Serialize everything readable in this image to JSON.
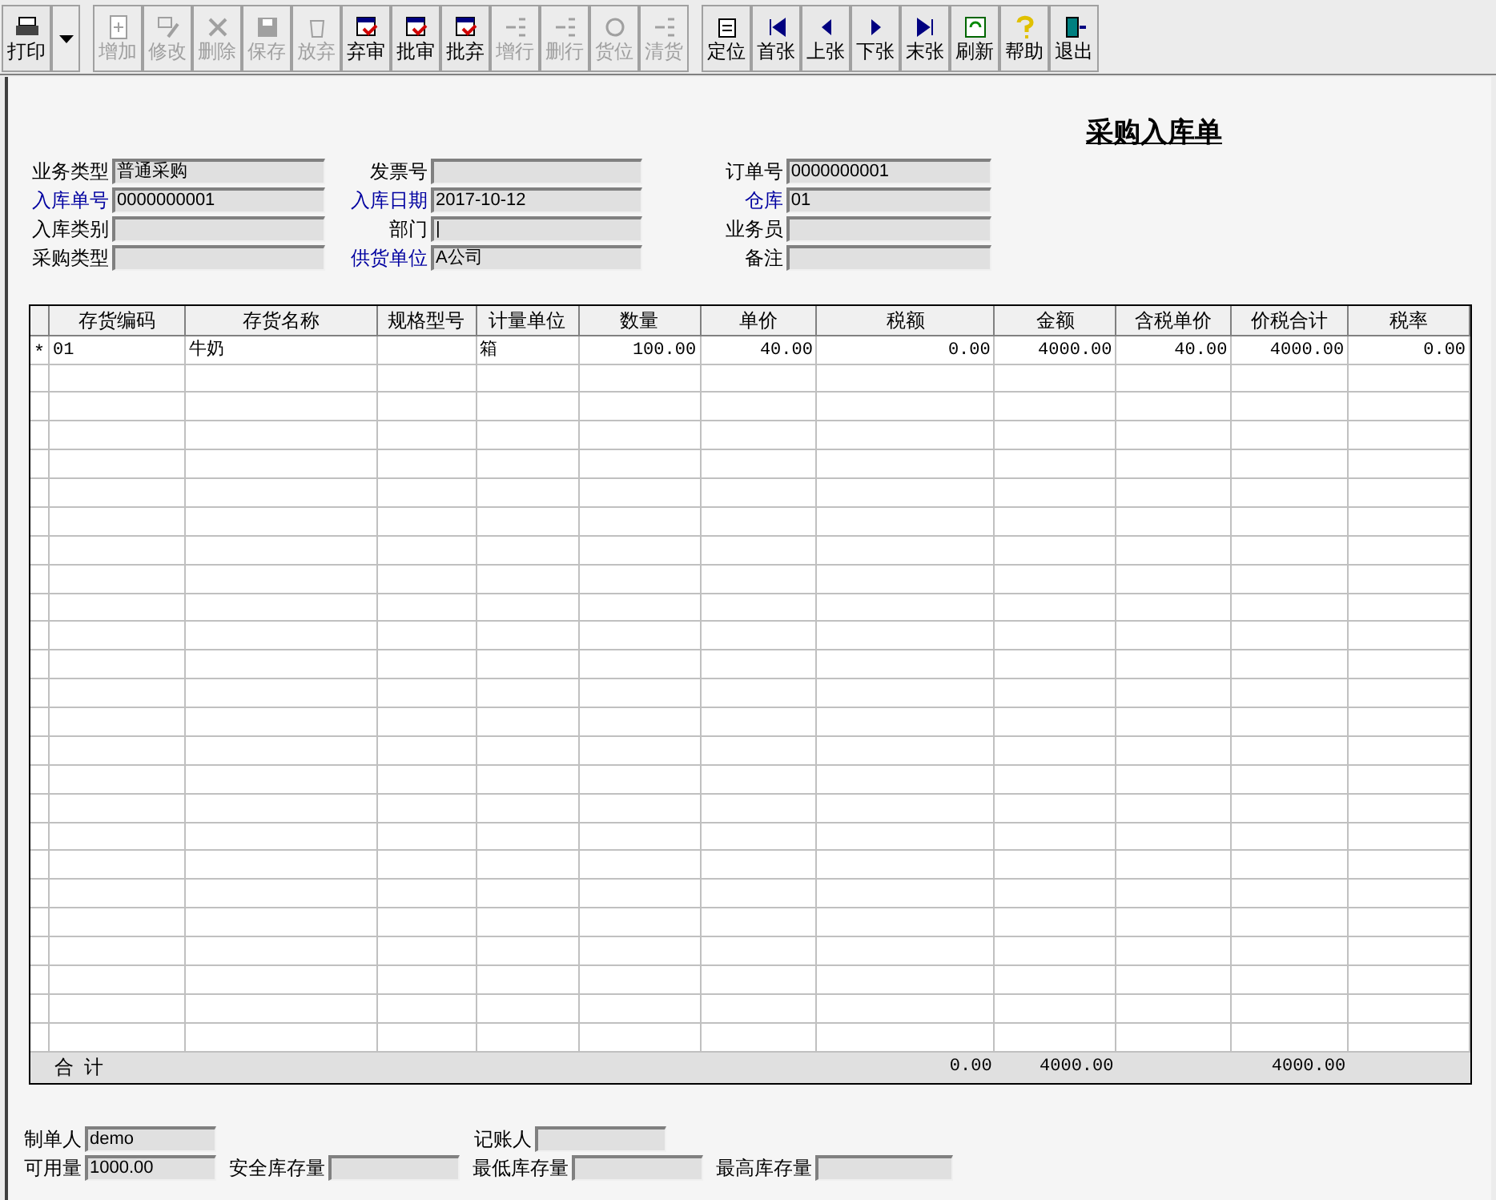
{
  "toolbar": {
    "groups": [
      [
        {
          "label": "打印",
          "disabled": false
        }
      ],
      [
        {
          "label": "增加",
          "disabled": true
        },
        {
          "label": "修改",
          "disabled": true
        },
        {
          "label": "删除",
          "disabled": true
        },
        {
          "label": "保存",
          "disabled": true
        },
        {
          "label": "放弃",
          "disabled": true
        },
        {
          "label": "弃审",
          "disabled": false
        },
        {
          "label": "批审",
          "disabled": false
        },
        {
          "label": "批弃",
          "disabled": false
        },
        {
          "label": "增行",
          "disabled": true
        },
        {
          "label": "删行",
          "disabled": true
        },
        {
          "label": "货位",
          "disabled": true
        },
        {
          "label": "清货",
          "disabled": true
        }
      ],
      [
        {
          "label": "定位",
          "disabled": false
        },
        {
          "label": "首张",
          "disabled": false
        },
        {
          "label": "上张",
          "disabled": false
        },
        {
          "label": "下张",
          "disabled": false
        },
        {
          "label": "末张",
          "disabled": false
        },
        {
          "label": "刷新",
          "disabled": false
        },
        {
          "label": "帮助",
          "disabled": false
        },
        {
          "label": "退出",
          "disabled": false
        }
      ]
    ]
  },
  "form": {
    "title": "采购入库单",
    "columns": [
      [
        {
          "label": "业务类型",
          "required": false,
          "value": "普通采购"
        },
        {
          "label": "入库单号",
          "required": true,
          "value": "0000000001"
        },
        {
          "label": "入库类别",
          "required": false
        },
        {
          "label": "采购类型",
          "required": false
        }
      ],
      [
        {
          "label": "发票号",
          "required": false
        },
        {
          "label": "入库日期",
          "required": true,
          "value": "2017-10-12"
        },
        {
          "label": "部门",
          "required": false,
          "value": "|"
        },
        {
          "label": "供货单位",
          "required": true,
          "value": "A公司"
        }
      ],
      [
        {
          "label": "订单号",
          "required": false,
          "value": "0000000001"
        },
        {
          "label": "仓库",
          "required": true,
          "value": "01"
        },
        {
          "label": "业务员",
          "required": false
        },
        {
          "label": "备注",
          "required": false
        }
      ]
    ]
  },
  "table": {
    "columns": [
      "存货编码",
      "存货名称",
      "规格型号",
      "计量单位",
      "数量",
      "单价",
      "税额",
      "金额",
      "含税单价",
      "价税合计",
      "税率"
    ],
    "rows": [
      {
        "marker": "*",
        "cells": [
          "01",
          "牛奶",
          null,
          "箱",
          "100.00",
          "40.00",
          "0.00",
          "4000.00",
          "40.00",
          "4000.00",
          "0.00"
        ]
      }
    ],
    "totals": {
      "label": "合  计",
      "cells": [
        null,
        null,
        null,
        null,
        null,
        null,
        "0.00",
        "4000.00",
        null,
        "4000.00",
        null
      ]
    }
  },
  "footer": [
    [
      {
        "label": "制单人",
        "value": "demo"
      },
      {
        "label": "记账人"
      }
    ],
    [
      {
        "label": "可用量",
        "value": "1000.00"
      },
      {
        "label": "安全库存量"
      },
      {
        "label": "最低库存量"
      },
      {
        "label": "最高库存量"
      }
    ]
  ]
}
